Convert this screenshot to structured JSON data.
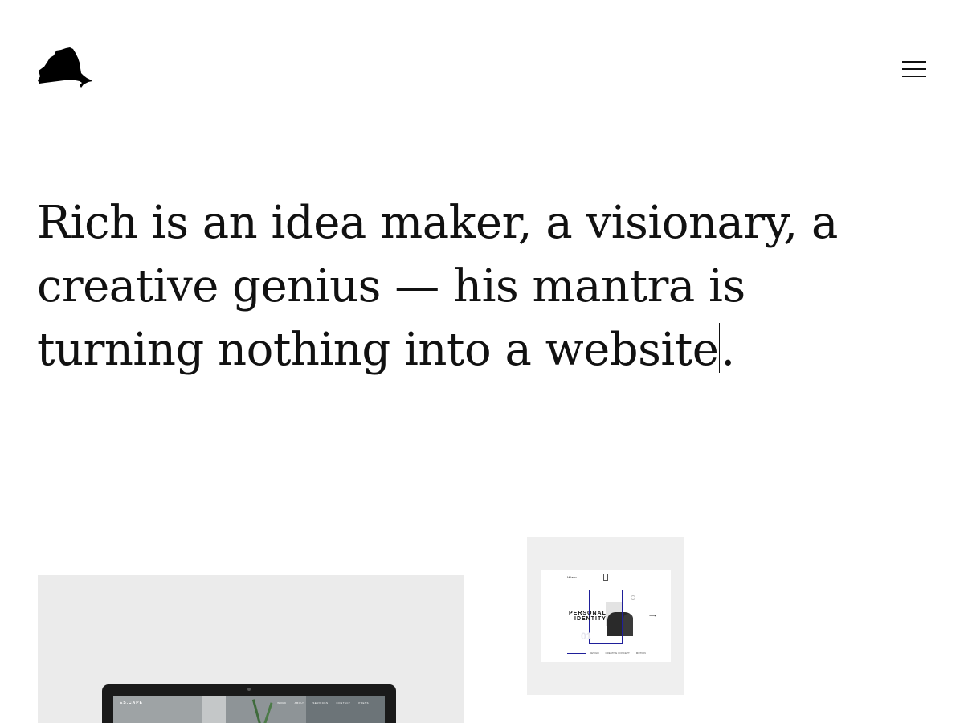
{
  "header": {
    "logo_icon": "new-york-state-silhouette-icon",
    "menu_icon": "hamburger-menu-icon"
  },
  "hero": {
    "line1": "Rich is an idea maker, a visionary, a",
    "line2": "creative genius — his mantra is",
    "line3_before_caret": "turning nothing into a website",
    "line3_after_caret": "."
  },
  "portfolio": {
    "card_large": {
      "screen_brand": "ES.CAPE",
      "screen_nav": [
        "WORK",
        "ABOUT",
        "SERVICES",
        "CONTACT",
        "PRESS"
      ]
    },
    "card_small": {
      "mock_brand": "Milano",
      "mock_title_line1": "PERSONAL",
      "mock_title_line2": "IDENTITY",
      "mock_number": "01",
      "mock_links": [
        "DESIGN",
        "CREATIVE CONCEPT",
        "MOTION"
      ]
    }
  },
  "colors": {
    "background": "#ffffff",
    "text": "#111111",
    "card_bg": "#ebebeb",
    "accent_blue": "#1f1f9a"
  }
}
